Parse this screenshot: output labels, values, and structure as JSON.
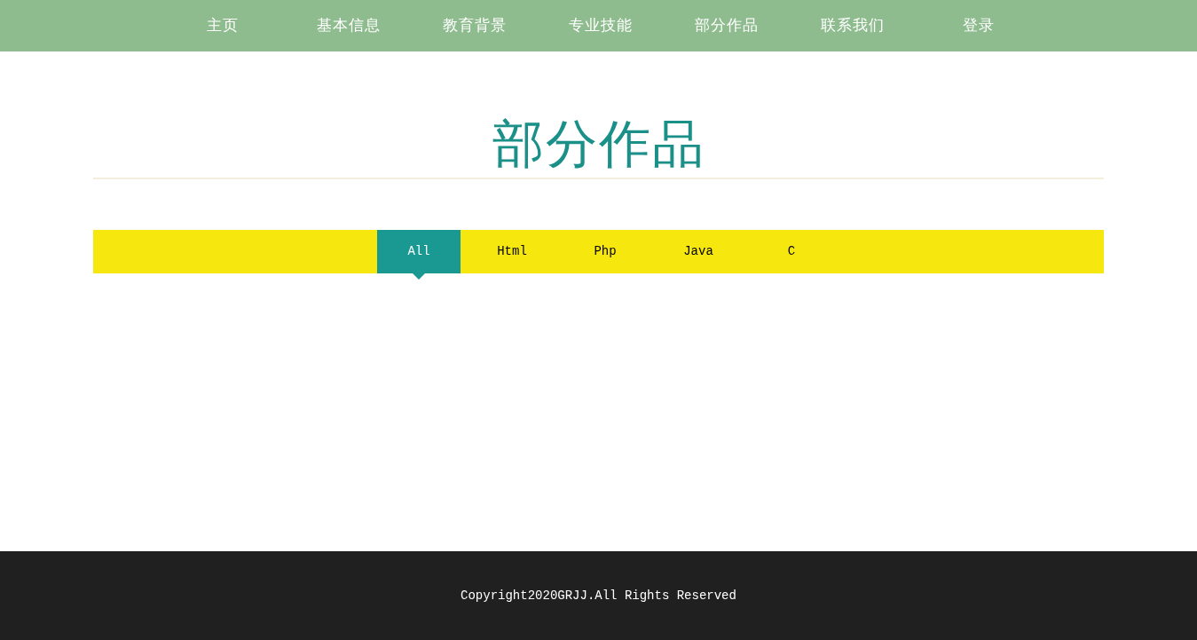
{
  "nav": {
    "items": [
      {
        "label": "主页"
      },
      {
        "label": "基本信息"
      },
      {
        "label": "教育背景"
      },
      {
        "label": "专业技能"
      },
      {
        "label": "部分作品"
      },
      {
        "label": "联系我们"
      },
      {
        "label": "登录"
      }
    ]
  },
  "section": {
    "title": "部分作品"
  },
  "filters": [
    {
      "label": "All",
      "selected": true
    },
    {
      "label": "Html",
      "selected": false
    },
    {
      "label": "Php",
      "selected": false
    },
    {
      "label": "Java",
      "selected": false
    },
    {
      "label": "C",
      "selected": false
    }
  ],
  "footer": {
    "text": "Copyright2020GRJJ.All Rights Reserved"
  }
}
